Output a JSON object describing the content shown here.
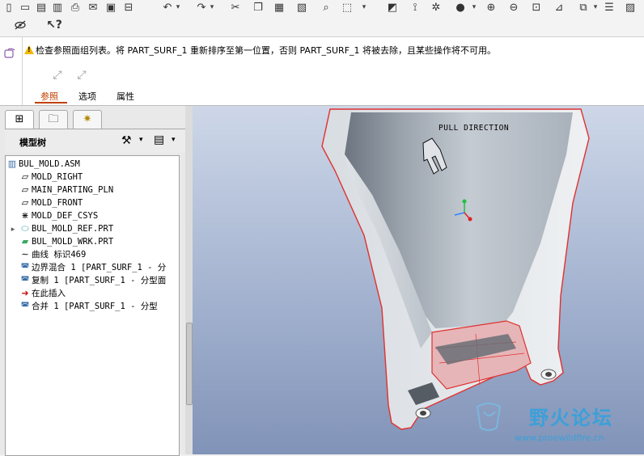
{
  "message": {
    "text": "检查参照面组列表。将 PART_SURF_1 重新排序至第一位置，否则 PART_SURF_1 将被去除，且某些操作将不可用。"
  },
  "dashboard": {
    "tabs": [
      {
        "label": "参照",
        "active": true
      },
      {
        "label": "选项"
      },
      {
        "label": "属性"
      }
    ],
    "accent_color": "#c04000"
  },
  "model_tree": {
    "title": "模型树",
    "items": [
      {
        "icon": "assembly-icon",
        "label": "BUL_MOLD.ASM"
      },
      {
        "icon": "datum-plane-icon",
        "label": "MOLD_RIGHT"
      },
      {
        "icon": "datum-plane-icon",
        "label": "MAIN_PARTING_PLN"
      },
      {
        "icon": "datum-plane-icon",
        "label": "MOLD_FRONT"
      },
      {
        "icon": "coordinate-system-icon",
        "label": "MOLD_DEF_CSYS"
      },
      {
        "icon": "part-icon",
        "label": "BUL_MOLD_REF.PRT"
      },
      {
        "icon": "part-icon",
        "label": "BUL_MOLD_WRK.PRT"
      },
      {
        "icon": "curve-icon",
        "label": "曲线 标识469"
      },
      {
        "icon": "surface-icon",
        "label": "边界混合 1 [PART_SURF_1 - 分"
      },
      {
        "icon": "surface-icon",
        "label": "复制 1 [PART_SURF_1 - 分型面"
      },
      {
        "icon": "insert-here-arrow-icon",
        "label": "在此插入"
      },
      {
        "icon": "merge-surface-icon",
        "label": "合并 1 [PART_SURF_1 - 分型"
      }
    ]
  },
  "viewport": {
    "label": "PULL DIRECTION",
    "watermark_text": "野火论坛",
    "watermark_url": "www.proewildfire.cn"
  }
}
